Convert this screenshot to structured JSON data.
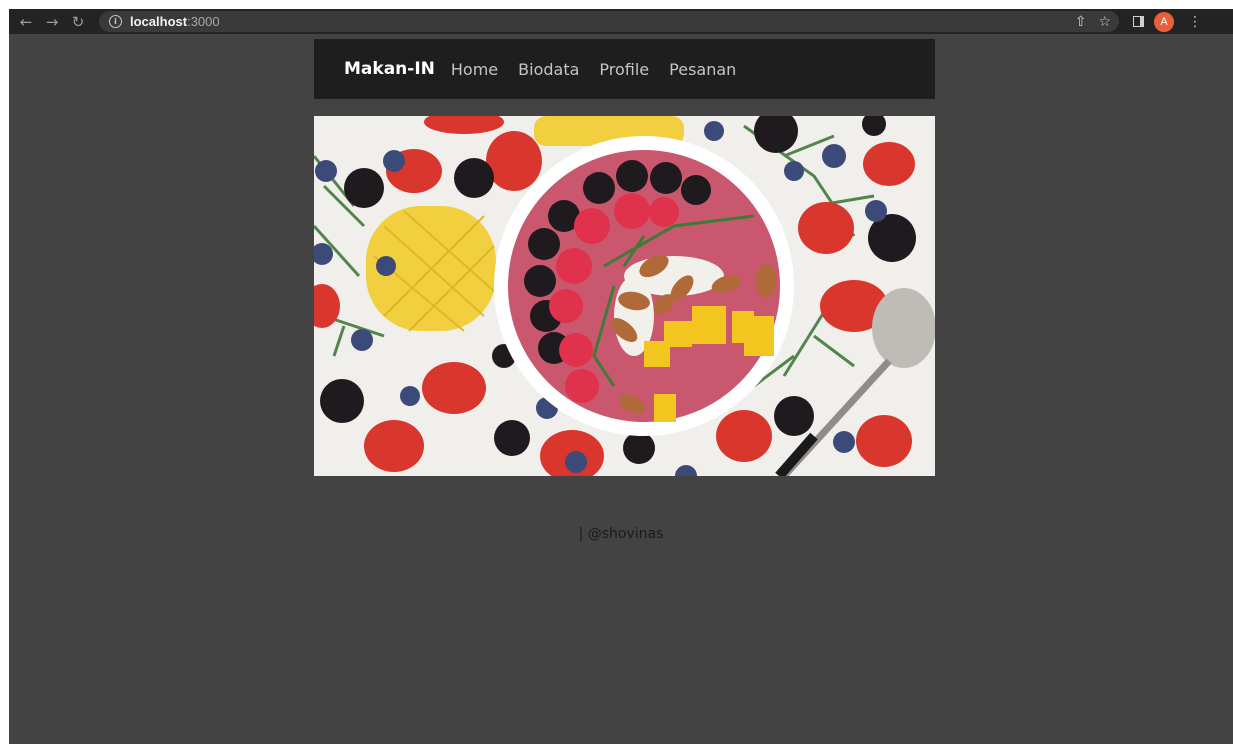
{
  "browser": {
    "url_host": "localhost",
    "url_port": ":3000",
    "avatar_letter": "A",
    "icons": [
      "back-arrow-icon",
      "forward-arrow-icon",
      "reload-icon",
      "info-icon",
      "share-icon",
      "star-icon",
      "side-panel-icon",
      "menu-dots-icon"
    ]
  },
  "navbar": {
    "brand": "Makan-IN",
    "links": [
      "Home",
      "Biodata",
      "Profile",
      "Pesanan"
    ]
  },
  "hero": {
    "image": "smoothie-bowl-fruit-photo"
  },
  "footer": {
    "text": "| @shovinas"
  },
  "colors": {
    "page_bg": "#434343",
    "navbar_bg": "#1e1e1e",
    "avatar": "#e8603a"
  }
}
